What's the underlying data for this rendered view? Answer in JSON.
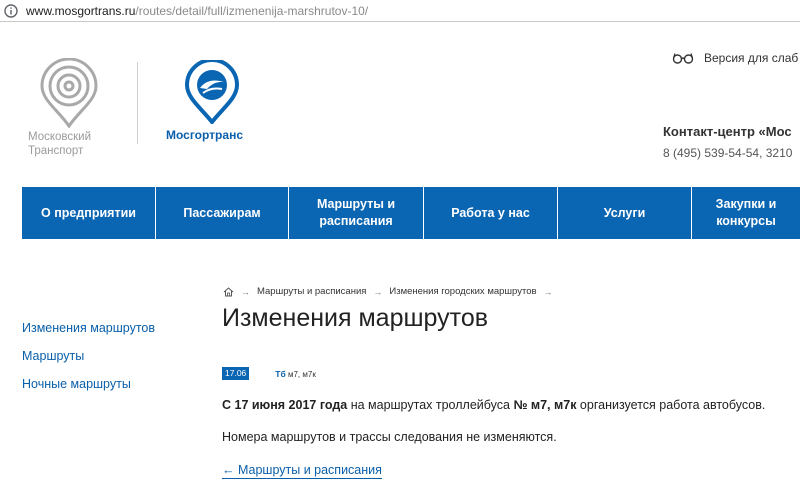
{
  "browser": {
    "url_host": "www.mosgortrans.ru",
    "url_path": "/routes/detail/full/izmenenija-marshrutov-10/"
  },
  "header": {
    "logo_left_line1": "Московский",
    "logo_left_line2": "Транспорт",
    "logo_right_name": "Мосгортранс",
    "vision_label": "Версия для слаб",
    "contact_title": "Контакт-центр «Мос",
    "contact_phone": "8 (495) 539-54-54, 3210",
    "brand_color": "#0a65b2"
  },
  "nav": {
    "items": [
      {
        "label": "О предприятии"
      },
      {
        "label": "Пассажирам"
      },
      {
        "label": "Маршруты и расписания"
      },
      {
        "label": "Работа у нас"
      },
      {
        "label": "Услуги"
      },
      {
        "label": "Закупки и конкурсы"
      }
    ]
  },
  "sidebar": {
    "items": [
      {
        "label": "Изменения маршрутов"
      },
      {
        "label": "Маршруты"
      },
      {
        "label": "Ночные маршруты"
      }
    ]
  },
  "breadcrumb": {
    "home_icon": "home-icon",
    "items": [
      {
        "label": "Маршруты и расписания"
      },
      {
        "label": "Изменения городских маршрутов"
      }
    ]
  },
  "main": {
    "title": "Изменения маршрутов",
    "date": "17.06",
    "tag_type": "Тб",
    "tag_routes": "м7, м7к",
    "p1_bold1": "С 17 июня 2017 года",
    "p1_text1": " на маршрутах троллейбуса ",
    "p1_bold2": "№ м7, м7к",
    "p1_text2": " организуется работа автобусов.",
    "p2": "Номера маршрутов и трассы следования не изменяются.",
    "back_link": "← Маршруты и расписания"
  }
}
